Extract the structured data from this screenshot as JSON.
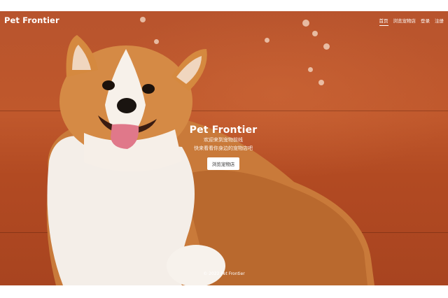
{
  "navbar": {
    "brand": "Pet Frontier",
    "links": [
      {
        "label": "首页",
        "active": true
      },
      {
        "label": "浏览宠物店",
        "active": false
      },
      {
        "label": "登录",
        "active": false
      },
      {
        "label": "注册",
        "active": false
      }
    ]
  },
  "hero": {
    "title": "Pet Frontier",
    "subtitle_line1": "欢迎来到宠物前线",
    "subtitle_line2": "快来看看你身边的宠物店吧",
    "cta_label": "浏览宠物店"
  },
  "footer": {
    "text": "© 2022 Pet Frontier"
  },
  "colors": {
    "background": "#b8542d",
    "text": "#ffffff",
    "button_bg": "#ffffff"
  }
}
